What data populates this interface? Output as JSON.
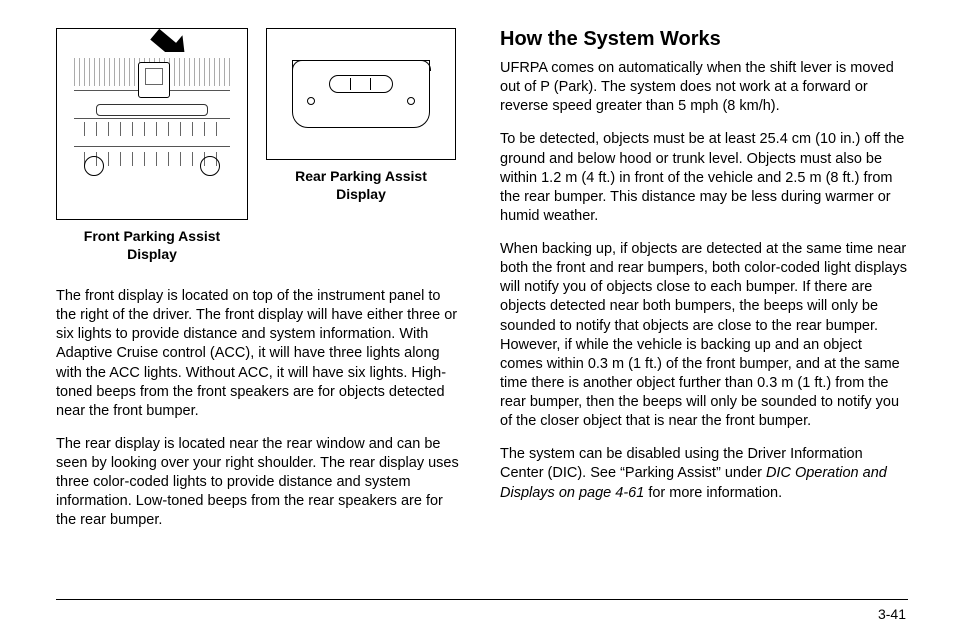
{
  "figures": {
    "front_caption": "Front Parking Assist\nDisplay",
    "rear_caption": "Rear Parking Assist\nDisplay"
  },
  "left_column": {
    "p1": "The front display is located on top of the instrument panel to the right of the driver. The front display will have either three or six lights to provide distance and system information. With Adaptive Cruise control (ACC), it will have three lights along with the ACC lights. Without ACC, it will have six lights. High-toned beeps from the front speakers are for objects detected near the front bumper.",
    "p2": "The rear display is located near the rear window and can be seen by looking over your right shoulder. The rear display uses three color-coded lights to provide distance and system information. Low-toned beeps from the rear speakers are for the rear bumper."
  },
  "right_column": {
    "heading": "How the System Works",
    "p1": "UFRPA comes on automatically when the shift lever is moved out of P (Park). The system does not work at a forward or reverse speed greater than 5 mph (8 km/h).",
    "p2": "To be detected, objects must be at least 25.4 cm (10 in.) off the ground and below hood or trunk level. Objects must also be within 1.2 m (4 ft.) in front of the vehicle and 2.5 m (8 ft.) from the rear bumper. This distance may be less during warmer or humid weather.",
    "p3": "When backing up, if objects are detected at the same time near both the front and rear bumpers, both color-coded light displays will notify you of objects close to each bumper. If there are objects detected near both bumpers, the beeps will only be sounded to notify that objects are close to the rear bumper. However, if while the vehicle is backing up and an object comes within 0.3 m (1 ft.) of the front bumper, and at the same time there is another object further than 0.3 m (1 ft.) from the rear bumper, then the beeps will only be sounded to notify you of the closer object that is near the front bumper.",
    "p4_pre": "The system can be disabled using the Driver Information Center (DIC). See “Parking Assist” under ",
    "p4_xref": "DIC Operation and Displays on page 4-61",
    "p4_post": " for more information."
  },
  "page_number": "3-41"
}
